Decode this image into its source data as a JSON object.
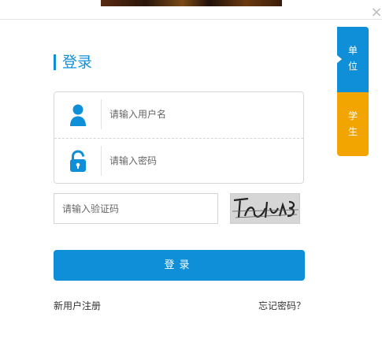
{
  "title": "登录",
  "close_icon": "×",
  "username": {
    "placeholder": "请输入用户名",
    "value": ""
  },
  "password": {
    "placeholder": "请输入密码",
    "value": ""
  },
  "captcha": {
    "placeholder": "请输入验证码",
    "value": ""
  },
  "login_label": "登录",
  "register_label": "新用户注册",
  "forgot_label": "忘记密码？",
  "tabs": [
    {
      "char1": "单",
      "char2": "位"
    },
    {
      "char1": "学",
      "char2": "生"
    }
  ],
  "colors": {
    "primary": "#0f8fd8",
    "secondary": "#f2a400"
  },
  "icons": {
    "user": "user-icon",
    "lock": "lock-icon",
    "close": "close-icon"
  }
}
